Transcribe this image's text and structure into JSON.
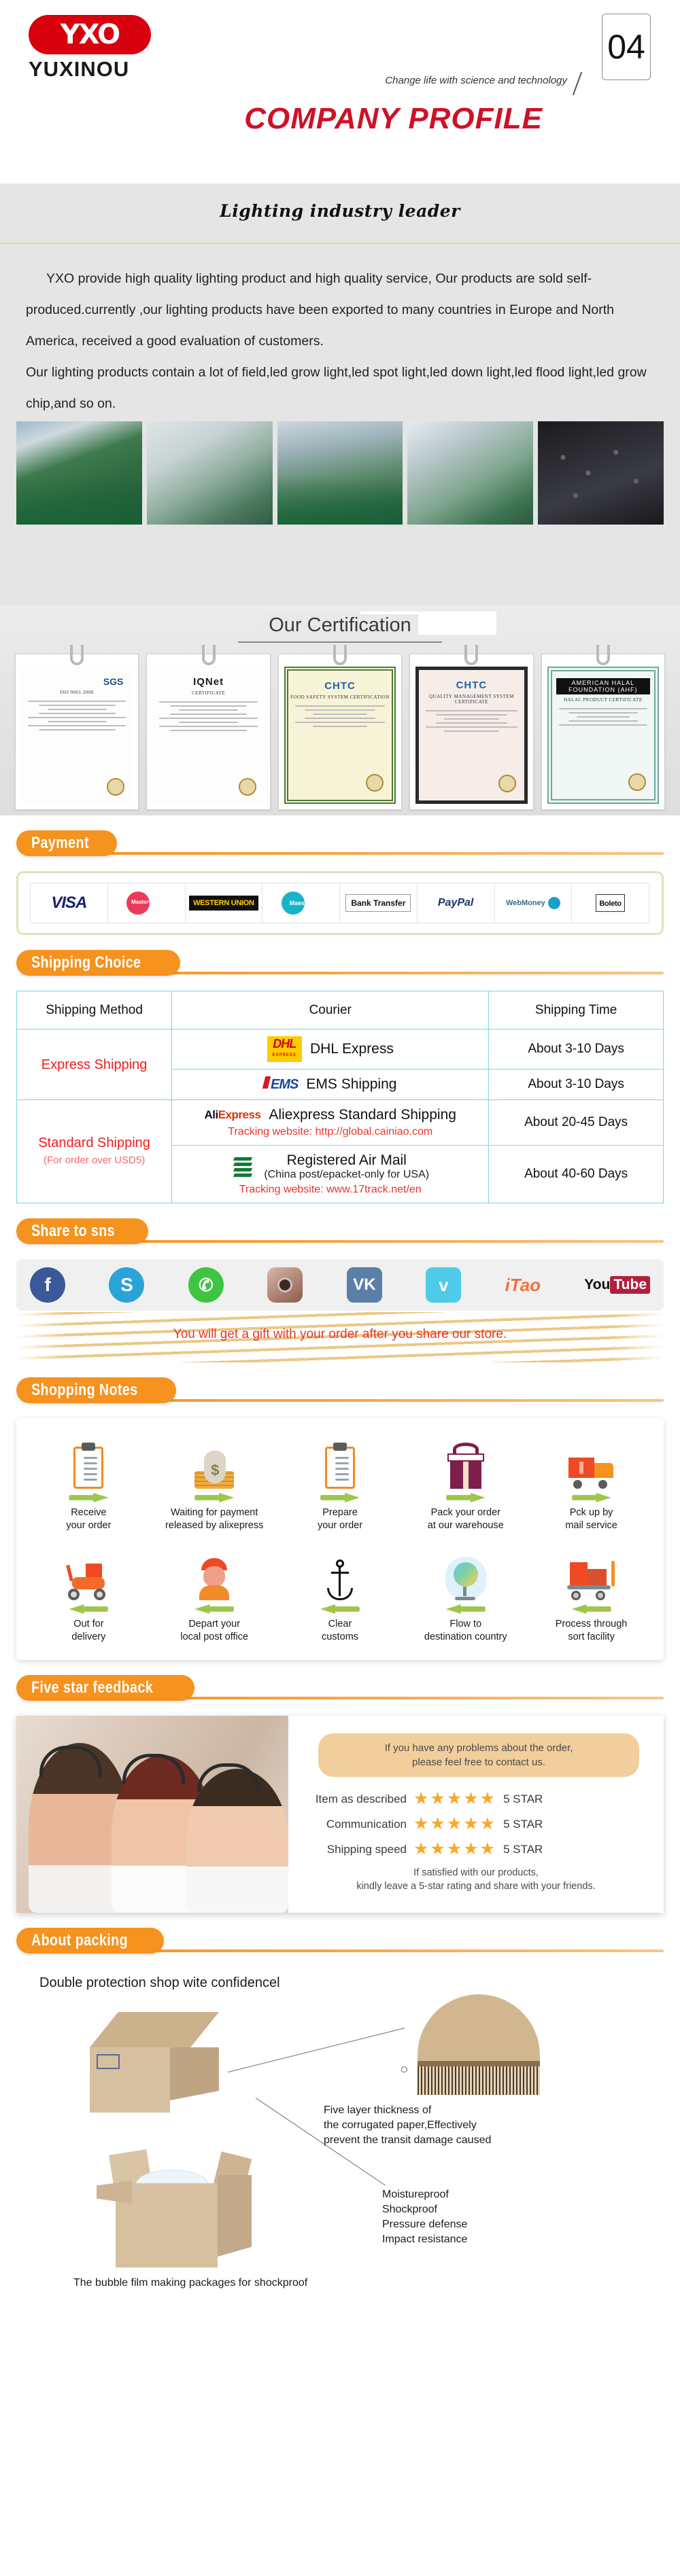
{
  "header": {
    "logo_mark": "YXO",
    "logo_name": "YUXINOU",
    "tagline": "Change life with science and technology",
    "title": "COMPANY PROFILE",
    "page_number": "04"
  },
  "intro": {
    "title": "Lighting industry leader",
    "paragraphs": [
      "YXO provide high quality lighting product and high quality service, Our products are sold self-produced.currently ,our lighting products have been exported to many countries in Europe and North America, received a good evaluation of customers.",
      "Our lighting products contain a lot of field,led grow light,led spot light,led down light,led flood light,led grow chip,and so on."
    ],
    "factory_photos": [
      "production-line-photo",
      "integrating-sphere-lab-photo",
      "smt-machine-photo",
      "inspection-station-photo",
      "showroom-photo"
    ]
  },
  "certification": {
    "title": "Our Certification",
    "cards": [
      {
        "brand": "SGS",
        "subtitle": "ISO 9001:2008",
        "kind": "plain"
      },
      {
        "brand": "IQNet",
        "subtitle": "CERTIFICATE",
        "kind": "plain"
      },
      {
        "brand": "CHTC",
        "subtitle": "FOOD SAFETY SYSTEM CERTIFICATION",
        "kind": "cream"
      },
      {
        "brand": "CHTC",
        "subtitle": "QUALITY MANAGEMENT SYSTEM CERTIFICATE",
        "kind": "pink"
      },
      {
        "brand": "AMERICAN HALAL FOUNDATION (AHF)",
        "subtitle": "HALAL PRODUCT CERTIFICATE",
        "kind": "teal"
      }
    ]
  },
  "payment": {
    "section_title": "Payment",
    "methods": [
      {
        "name": "visa-logo",
        "label": "VISA"
      },
      {
        "name": "mastercard-logo",
        "label": "MasterCard"
      },
      {
        "name": "western-union-logo",
        "label": "WESTERN UNION"
      },
      {
        "name": "maestro-logo",
        "label": "Maestro"
      },
      {
        "name": "bank-transfer-logo",
        "label": "Bank Transfer"
      },
      {
        "name": "paypal-logo",
        "label": "PayPal"
      },
      {
        "name": "webmoney-logo",
        "label": "WebMoney"
      },
      {
        "name": "boleto-logo",
        "label": "Boleto"
      }
    ]
  },
  "shipping": {
    "section_title": "Shipping Choice",
    "columns": [
      "Shipping Method",
      "Courier",
      "Shipping Time"
    ],
    "rows": [
      {
        "method": "Express Shipping",
        "method_note": "",
        "courier": "DHL Express",
        "courier_logo": "dhl-logo",
        "courier_sub": "",
        "tracking": "",
        "time": "About 3-10 Days"
      },
      {
        "method": "",
        "method_note": "",
        "courier": "EMS Shipping",
        "courier_logo": "ems-logo",
        "courier_sub": "",
        "tracking": "",
        "time": "About 3-10 Days"
      },
      {
        "method": "Standard Shipping",
        "method_note": "(For order over USD5)",
        "courier": "Aliexpress Standard Shipping",
        "courier_logo": "aliexpress-logo",
        "courier_sub": "",
        "tracking": "Tracking website: http://global.cainiao.com",
        "time": "About 20-45 Days"
      },
      {
        "method": "",
        "method_note": "",
        "courier": "Registered Air Mail",
        "courier_logo": "china-post-logo",
        "courier_sub": "(China post/epacket-only for USA)",
        "tracking": "Tracking website: www.17track.net/en",
        "time": "About 40-60 Days"
      }
    ]
  },
  "share": {
    "section_title": "Share to sns",
    "networks": [
      {
        "name": "facebook-icon",
        "label": "f"
      },
      {
        "name": "skype-icon",
        "label": "S"
      },
      {
        "name": "whatsapp-icon",
        "label": "✆"
      },
      {
        "name": "instagram-icon",
        "label": ""
      },
      {
        "name": "vk-icon",
        "label": "VK"
      },
      {
        "name": "twitter-icon",
        "label": "ᴠ"
      },
      {
        "name": "itao-icon",
        "label": "iTao"
      },
      {
        "name": "youtube-icon",
        "label": "YouTube"
      }
    ],
    "youtube_you": "You",
    "youtube_tube": "Tube",
    "gift_text": "You will get a gift with your order after you share our store."
  },
  "shopping_notes": {
    "section_title": "Shopping Notes",
    "row1": [
      {
        "icon": "clipboard-icon",
        "label": "Receive\nyour order"
      },
      {
        "icon": "money-bag-icon",
        "label": "Waiting for payment\nreleased by alixepress"
      },
      {
        "icon": "clipboard-icon",
        "label": "Prepare\nyour order"
      },
      {
        "icon": "gift-box-icon",
        "label": "Pack your order\nat our warehouse"
      },
      {
        "icon": "delivery-truck-icon",
        "label": "Pck up by\nmail service"
      }
    ],
    "row2": [
      {
        "icon": "scooter-icon",
        "label": "Out for\ndelivery"
      },
      {
        "icon": "postman-icon",
        "label": "Depart your\nlocal post office"
      },
      {
        "icon": "anchor-icon",
        "label": "Clear\ncustoms"
      },
      {
        "icon": "globe-icon",
        "label": "Flow to\ndestination country"
      },
      {
        "icon": "parcel-cart-icon",
        "label": "Process through\nsort facility"
      }
    ]
  },
  "feedback": {
    "section_title": "Five star feedback",
    "bubble": "If you have any problems about the order,\nplease feel free to contact us.",
    "ratings": [
      {
        "label": "Item as described",
        "stars": 5,
        "value": "5 STAR"
      },
      {
        "label": "Communication",
        "stars": 5,
        "value": "5 STAR"
      },
      {
        "label": "Shipping speed",
        "stars": 5,
        "value": "5 STAR"
      }
    ],
    "footer": "If satisfied with our products,\nkindly leave a 5-star rating and share with your friends."
  },
  "packing": {
    "section_title": "About packing",
    "headline": "Double protection shop wite confidencel",
    "callout1": "Five layer thickness of\nthe corrugated paper,Effectively\nprevent the transit damage caused",
    "callout2": "Moistureproof\nShockproof\nPressure defense\nImpact resistance",
    "caption": "The bubble film making packages for shockproof"
  }
}
